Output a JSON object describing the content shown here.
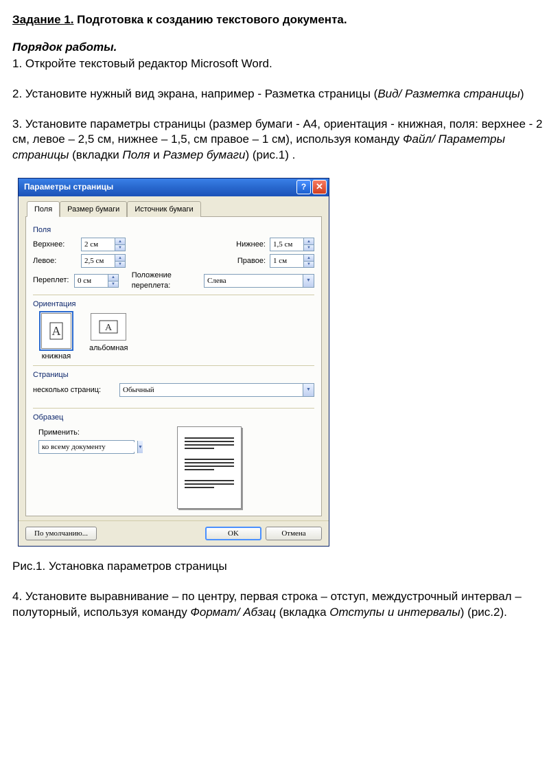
{
  "doc": {
    "task_label": "Задание 1.",
    "task_title_rest": " Подготовка к созданию текстового документа.",
    "subtitle": "Порядок работы.",
    "p1": "1. Откройте текстовый редактор Microsoft Word.",
    "p2a": "2. Установите нужный вид экрана, например - Разметка страницы (",
    "p2b": "Вид/ Разметка страницы",
    "p2c": ")",
    "p3a": "3. Установите параметры страницы (размер бумаги - А4, ориентация - книжная, поля: верхнее - 2 см, левое – 2,5 см, нижнее – 1,5, см правое – 1 см), используя команду ",
    "p3b": "Файл/ Параметры страницы",
    "p3c": " (вкладки ",
    "p3d": "Поля",
    "p3e": " и ",
    "p3f": "Размер бумаги",
    "p3g": ") (рис.1) .",
    "fig1": "Рис.1. Установка параметров страницы",
    "p4a": "4. Установите выравнивание – по центру, первая строка – отступ, междустрочный интервал – полуторный, используя команду ",
    "p4b": "Формат/ Абзац",
    "p4c": " (вкладка ",
    "p4d": "Отступы и интервалы",
    "p4e": ") (рис.2)."
  },
  "dialog": {
    "title": "Параметры страницы",
    "tabs": {
      "t1": "Поля",
      "t2": "Размер бумаги",
      "t3": "Источник бумаги"
    },
    "groups": {
      "fields": "Поля",
      "orientation": "Ориентация",
      "pages": "Страницы",
      "sample": "Образец"
    },
    "labels": {
      "top": "Верхнее:",
      "bottom": "Нижнее:",
      "left": "Левое:",
      "right": "Правое:",
      "gutter": "Переплет:",
      "gutterpos": "Положение переплета:",
      "portrait": "книжная",
      "landscape": "альбомная",
      "multi": "несколько страниц:",
      "apply": "Применить:"
    },
    "values": {
      "top": "2 см",
      "bottom": "1,5 см",
      "left": "2,5 см",
      "right": "1 см",
      "gutter": "0 см",
      "gutterpos": "Слева",
      "multi": "Обычный",
      "apply": "ко всему документу"
    },
    "buttons": {
      "default": "По умолчанию...",
      "ok": "OK",
      "cancel": "Отмена"
    }
  }
}
